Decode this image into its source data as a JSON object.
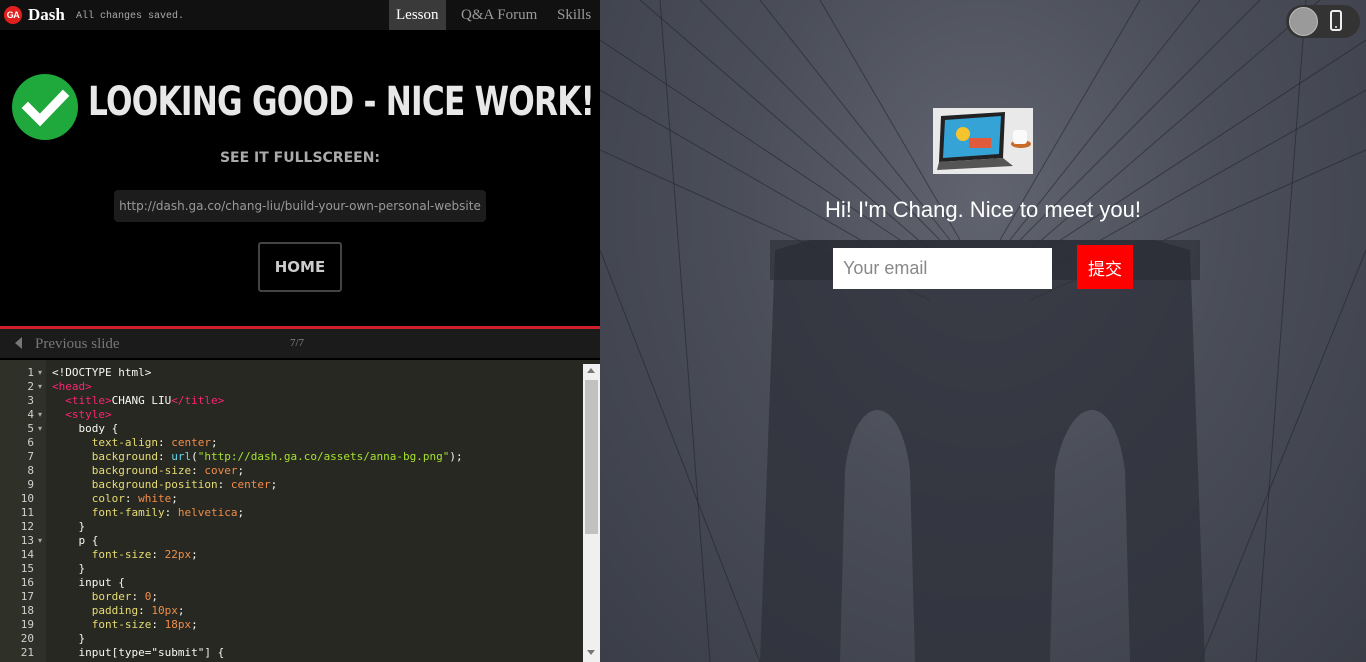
{
  "app": {
    "logo_text": "GA",
    "title": "Dash",
    "save_status": "All changes saved."
  },
  "tabs": [
    {
      "label": "Lesson",
      "active": true
    },
    {
      "label": "Q&A Forum",
      "active": false
    },
    {
      "label": "Skills",
      "active": false
    }
  ],
  "success": {
    "headline": "LOOKING GOOD - NICE WORK!",
    "fullscreen_label": "SEE IT FULLSCREEN:",
    "fullscreen_url": "http://dash.ga.co/chang-liu/build-your-own-personal-website",
    "home_button": "HOME"
  },
  "slide_nav": {
    "previous_label": "Previous slide",
    "counter": "7/7"
  },
  "editor": {
    "line_numbers": [
      "1",
      "2",
      "3",
      "4",
      "5",
      "6",
      "7",
      "8",
      "9",
      "10",
      "11",
      "12",
      "13",
      "14",
      "15",
      "16",
      "17",
      "18",
      "19",
      "20",
      "21"
    ],
    "lines": [
      "<!DOCTYPE html>",
      "<head>",
      "  <title>CHANG LIU</title>",
      "  <style>",
      "    body {",
      "      text-align: center;",
      "      background: url(\"http://dash.ga.co/assets/anna-bg.png\");",
      "      background-size: cover;",
      "      background-position: center;",
      "      color: white;",
      "      font-family: helvetica;",
      "    }",
      "    p {",
      "      font-size: 22px;",
      "    }",
      "    input {",
      "      border: 0;",
      "      padding: 10px;",
      "      font-size: 18px;",
      "    }",
      "    input[type=\"submit\"] {"
    ]
  },
  "preview": {
    "greeting": "Hi! I'm Chang. Nice to meet you!",
    "email_placeholder": "Your email",
    "submit_label": "提交",
    "device_icons": [
      "circle-toggle-icon",
      "phone-icon"
    ]
  },
  "colors": {
    "accent_red": "#d0202a",
    "success_green": "#1fa83c",
    "submit_red": "#ff0000"
  }
}
